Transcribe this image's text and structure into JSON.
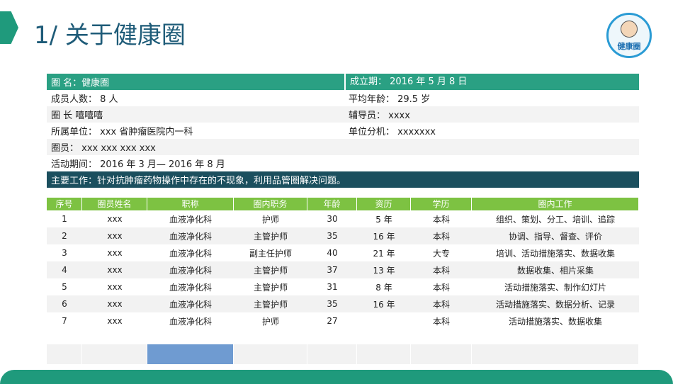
{
  "title": "1/ 关于健康圈",
  "logo_text": "健康圈",
  "info": {
    "header_left": "圈 名：健康圈",
    "header_right": "成立期： 2016 年 5 月 8 日",
    "members_count": "成员人数： 8 人",
    "avg_age": "平均年龄： 29.5 岁",
    "leader": "圈 长 嘻嘻嘻",
    "counselor": "辅导员： xxxx",
    "unit": "所属单位： xxx 省肿瘤医院内一科",
    "branch": "单位分机： xxxxxxx",
    "members": "圈员： xxx xxx xxx xxx",
    "period": "活动期间： 2016 年 3 月— 2016 年 8 月",
    "main_work": "主要工作：针对抗肿瘤药物操作中存在的不现象，利用品管圈解决问题。"
  },
  "table": {
    "headers": [
      "序号",
      "圈员姓名",
      "职称",
      "圈内职务",
      "年龄",
      "资历",
      "学历",
      "圈内工作"
    ],
    "rows": [
      [
        "1",
        "xxx",
        "血液净化科",
        "护师",
        "30",
        "5 年",
        "本科",
        "组织、策划、分工、培训、追踪"
      ],
      [
        "2",
        "xxx",
        "血液净化科",
        "主管护师",
        "35",
        "16 年",
        "本科",
        "协调、指导、督查、评价"
      ],
      [
        "3",
        "xxx",
        "血液净化科",
        "副主任护师",
        "40",
        "21 年",
        "大专",
        "培训、活动措施落实、数据收集"
      ],
      [
        "4",
        "xxx",
        "血液净化科",
        "主管护师",
        "37",
        "13 年",
        "本科",
        "数据收集、相片采集"
      ],
      [
        "5",
        "xxx",
        "血液净化科",
        "主管护师",
        "31",
        "8 年",
        "本科",
        "活动措施落实、制作幻灯片"
      ],
      [
        "6",
        "xxx",
        "血液净化科",
        "主管护师",
        "35",
        "16 年",
        "本科",
        "活动措施落实、数据分析、记录"
      ],
      [
        "7",
        "xxx",
        "血液净化科",
        "护师",
        "27",
        "",
        "本科",
        "活动措施落实、数据收集"
      ]
    ]
  }
}
